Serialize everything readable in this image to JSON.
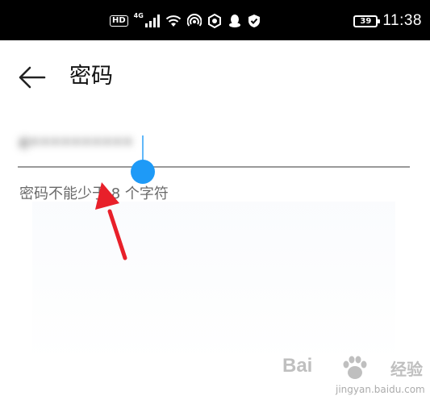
{
  "status_bar": {
    "network_hd": "HD",
    "network_type": "4G",
    "battery": "39",
    "time": "11:38",
    "icons": [
      "hd-icon",
      "signal-icon",
      "wifi-icon",
      "hotspot-icon",
      "app-icon",
      "qq-icon",
      "shield-icon"
    ]
  },
  "header": {
    "back_icon": "back-arrow-icon",
    "title": "密码"
  },
  "password_field": {
    "value": "e••••••••••"
  },
  "hint": {
    "text": "密码不能少于 8 个字符"
  },
  "colors": {
    "accent": "#1e9af7",
    "annotation_arrow": "#e8202a",
    "status_bar_bg": "#000000"
  },
  "watermark": {
    "logo": "Bai",
    "logo_suffix": "经验",
    "url": "jingyan.baidu.com"
  }
}
